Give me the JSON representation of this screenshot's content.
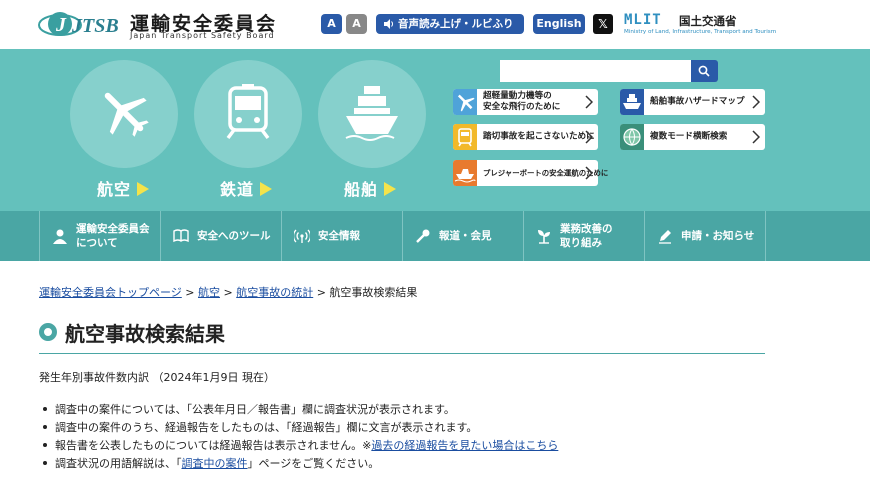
{
  "header": {
    "logo_abbr": "JTSB",
    "logo_title": "運輸安全委員会",
    "logo_subtitle": "Japan Transport Safety Board",
    "font_btn_large": "A",
    "font_btn_small": "A",
    "voice_label": "音声読み上げ・ルビふり",
    "english_label": "English",
    "x_label": "𝕏",
    "mlit_logo": "MLIT",
    "mlit_jp": "国土交通省",
    "mlit_en": "Ministry of Land, Infrastructure, Transport and Tourism"
  },
  "hero": {
    "categories": [
      {
        "label": "航空",
        "icon": "airplane-icon"
      },
      {
        "label": "鉄道",
        "icon": "train-icon"
      },
      {
        "label": "船舶",
        "icon": "ship-icon"
      }
    ],
    "search_placeholder": "",
    "links": [
      {
        "label_1": "超軽量動力機等の",
        "label_2": "安全な飛行のために",
        "icon": "plane-icon",
        "color": "#4fa3d9"
      },
      {
        "label_1": "踏切事故を起こさないために",
        "label_2": "",
        "icon": "train-small-icon",
        "color": "#f2b92a"
      },
      {
        "label_1": "プレジャーボートの安全運航のために",
        "label_2": "",
        "icon": "boat-icon",
        "color": "#e87a2e"
      },
      {
        "label_1": "船舶事故ハザードマップ",
        "label_2": "",
        "icon": "ship-small-icon",
        "color": "#2a5aa8"
      },
      {
        "label_1": "複数モード横断検索",
        "label_2": "",
        "icon": "globe-icon",
        "color": "#3a8f7a"
      }
    ]
  },
  "nav": {
    "items": [
      {
        "label_1": "運輸安全委員会",
        "label_2": "について",
        "icon": "person-icon"
      },
      {
        "label_1": "安全へのツール",
        "label_2": "",
        "icon": "book-icon"
      },
      {
        "label_1": "安全情報",
        "label_2": "",
        "icon": "broadcast-icon"
      },
      {
        "label_1": "報道・会見",
        "label_2": "",
        "icon": "microphone-icon"
      },
      {
        "label_1": "業務改善の",
        "label_2": "取り組み",
        "icon": "sprout-icon"
      },
      {
        "label_1": "申請・お知らせ",
        "label_2": "",
        "icon": "pencil-icon"
      }
    ]
  },
  "breadcrumb": {
    "home": "運輸安全委員会トップページ",
    "sep": " > ",
    "aviation": "航空",
    "stats": "航空事故の統計",
    "current": "航空事故検索結果"
  },
  "main": {
    "title": "航空事故検索結果",
    "summary": "発生年別事故件数内訳 （2024年1月9日 現在）",
    "notes": [
      {
        "text": "調査中の案件については、「公表年月日／報告書」欄に調査状況が表示されます。"
      },
      {
        "text": "調査中の案件のうち、経過報告をしたものは、「経過報告」欄に文言が表示されます。"
      },
      {
        "text": "報告書を公表したものについては経過報告は表示されません。※",
        "link": "過去の経過報告を見たい場合はこちら"
      },
      {
        "text": "調査状況の用語解説は、「",
        "link": "調査中の案件",
        "text_after": "」ページをご覧ください。"
      }
    ]
  },
  "colors": {
    "teal": "#64c1bc",
    "nav_teal": "#4aa6a4",
    "blue": "#2a5aa8",
    "arrow_yellow": "#f4e34a"
  }
}
